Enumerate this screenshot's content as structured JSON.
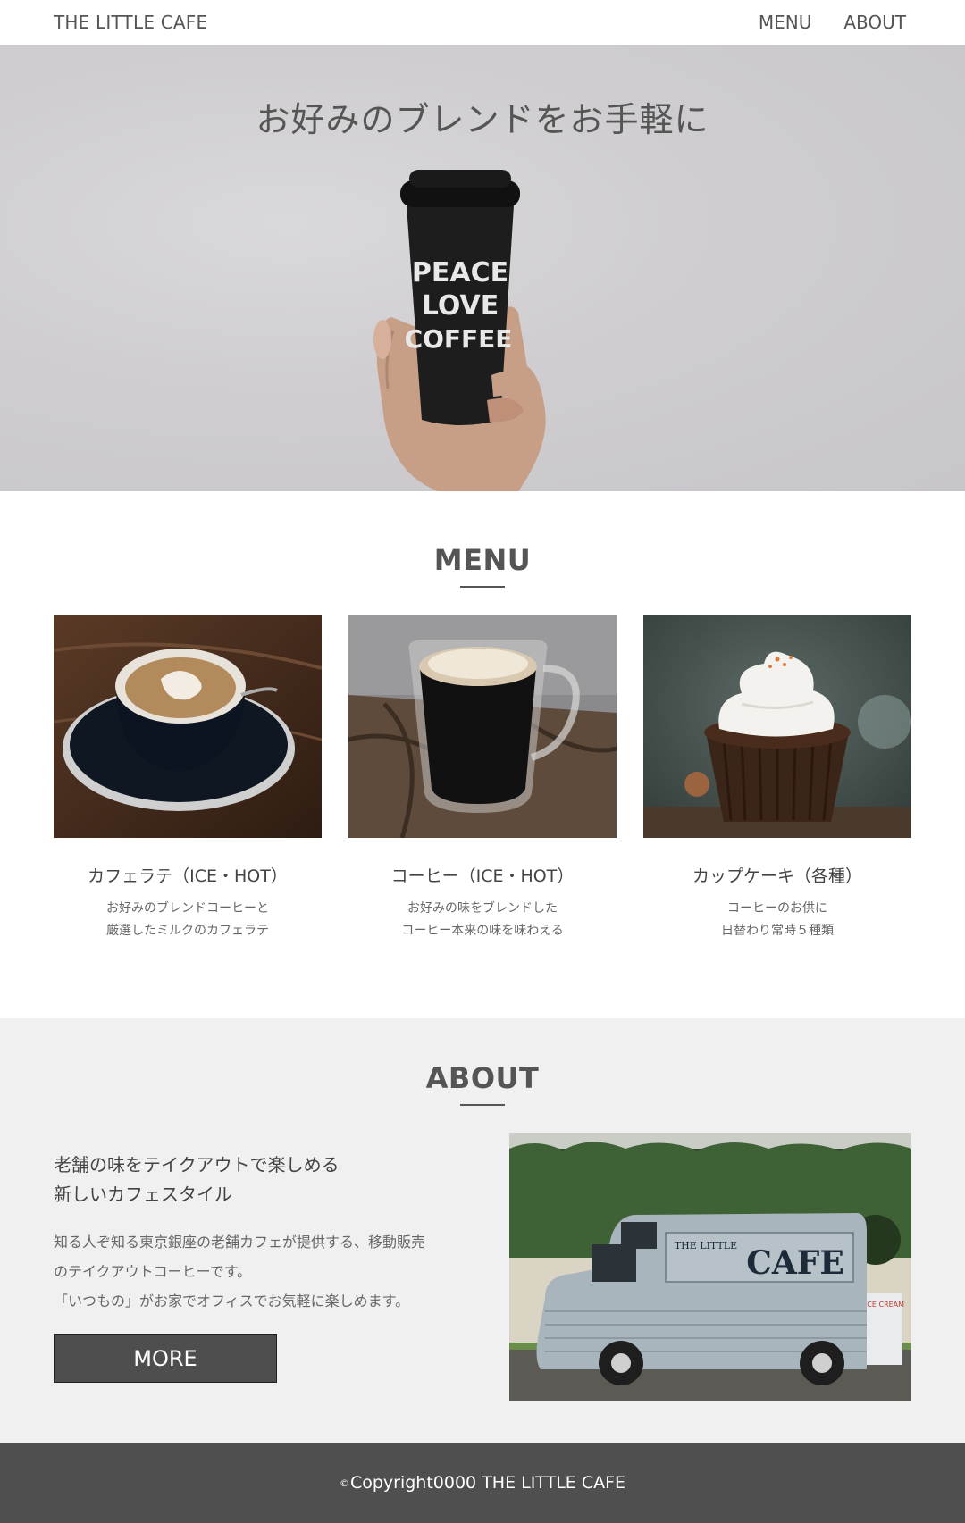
{
  "header": {
    "logo": "THE LITTLE CAFE",
    "nav": [
      "MENU",
      "ABOUT"
    ]
  },
  "hero": {
    "title": "お好みのブレンドをお手軽に",
    "cup_lines": [
      "PEACE",
      "LOVE",
      "COFFEE"
    ]
  },
  "menu": {
    "title": "MENU",
    "items": [
      {
        "name": "カフェラテ（ICE・HOT）",
        "desc": [
          "お好みのブレンドコーヒーと",
          "厳選したミルクのカフェラテ"
        ]
      },
      {
        "name": "コーヒー（ICE・HOT）",
        "desc": [
          "お好みの味をブレンドした",
          "コーヒー本来の味を味わえる"
        ]
      },
      {
        "name": "カップケーキ（各種）",
        "desc": [
          "コーヒーのお供に",
          "日替わり常時５種類"
        ]
      }
    ]
  },
  "about": {
    "title": "ABOUT",
    "heading": [
      "老舗の味をテイクアウトで楽しめる",
      "新しいカフェスタイル"
    ],
    "paragraph": [
      "知る人ぞ知る東京銀座の老舗カフェが提供する、移動販売",
      "のテイクアウトコーヒーです。",
      "「いつもの」がお家でオフィスでお気軽に楽しめます。"
    ],
    "button": "MORE",
    "truck_sign_small": "THE LITTLE",
    "truck_sign_big": "CAFE",
    "side_sign": "ICE CREAM"
  },
  "footer": {
    "copy_symbol": "©",
    "text": "Copyright0000 THE LITTLE CAFE"
  }
}
